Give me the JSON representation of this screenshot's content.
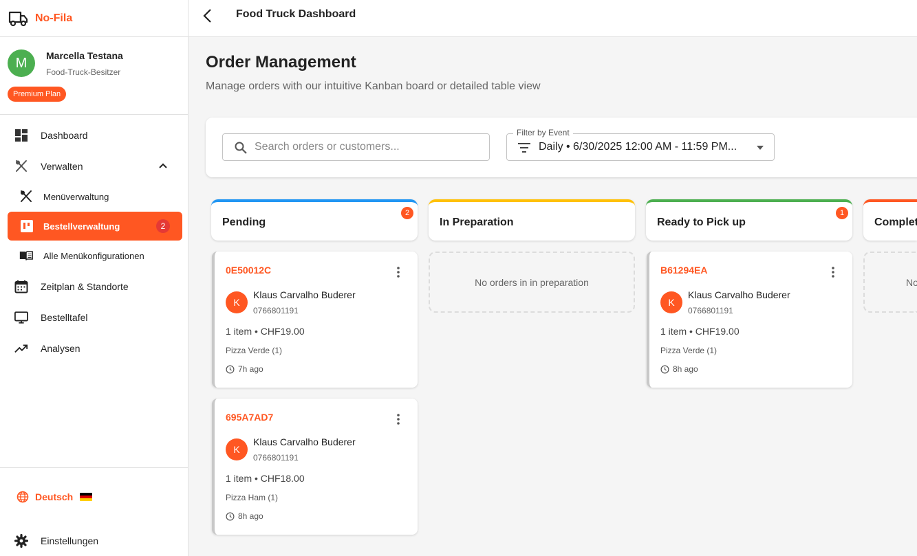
{
  "app": {
    "brand": "No-Fila",
    "page_title": "Food Truck Dashboard"
  },
  "user": {
    "initial": "M",
    "name": "Marcella Testana",
    "role": "Food-Truck-Besitzer",
    "plan": "Premium Plan"
  },
  "nav": {
    "dashboard": "Dashboard",
    "manage": "Verwalten",
    "menu_admin": "Menüverwaltung",
    "orders": "Bestellverwaltung",
    "orders_badge": "2",
    "menu_configs": "Alle Menükonfigurationen",
    "schedule": "Zeitplan & Standorte",
    "board": "Bestelltafel",
    "analytics": "Analysen"
  },
  "footer": {
    "language": "Deutsch",
    "settings": "Einstellungen"
  },
  "main": {
    "title": "Order Management",
    "subtitle": "Manage orders with our intuitive Kanban board or detailed table view",
    "search_placeholder": "Search orders or customers...",
    "event_label": "Filter by Event",
    "event_value": "Daily • 6/30/2025 12:00 AM - 11:59 PM..."
  },
  "columns": {
    "pending": {
      "title": "Pending",
      "count": "2",
      "color": "#2196f3"
    },
    "preparation": {
      "title": "In Preparation",
      "color": "#ffc107",
      "empty": "No orders in in preparation"
    },
    "ready": {
      "title": "Ready to Pick up",
      "count": "1",
      "color": "#4caf50"
    },
    "completed": {
      "title": "Completed",
      "color": "#ff5722",
      "empty": "No orders completed"
    }
  },
  "orders": [
    {
      "id": "0E50012C",
      "initial": "K",
      "customer": "Klaus Carvalho Buderer",
      "phone": "0766801191",
      "summary": "1 item • CHF19.00",
      "items": "Pizza Verde (1)",
      "time": "7h ago"
    },
    {
      "id": "695A7AD7",
      "initial": "K",
      "customer": "Klaus Carvalho Buderer",
      "phone": "0766801191",
      "summary": "1 item • CHF18.00",
      "items": "Pizza Ham (1)",
      "time": "8h ago"
    },
    {
      "id": "B61294EA",
      "initial": "K",
      "customer": "Klaus Carvalho Buderer",
      "phone": "0766801191",
      "summary": "1 item • CHF19.00",
      "items": "Pizza Verde (1)",
      "time": "8h ago"
    }
  ]
}
